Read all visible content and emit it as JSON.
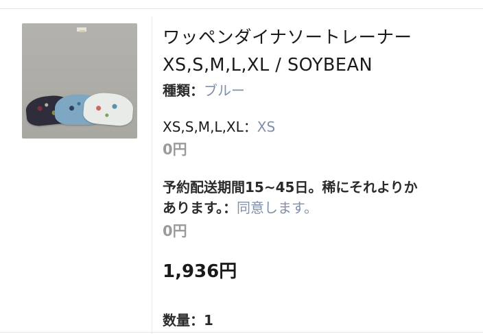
{
  "item": {
    "title_line1": "ワッペンダイナソートレーナー",
    "title_line2": "XS,S,M,L,XL  /  SOYBEAN",
    "type_label": "種類：",
    "type_value": "ブルー",
    "size_label": "XS,S,M,L,XL：",
    "size_value": "XS",
    "size_price": "0円",
    "delivery_label_line1": "予約配送期間15~45日。稀にそれよりか",
    "delivery_label_line2": "あります。：",
    "delivery_value": "同意します。",
    "delivery_price": "0円",
    "total_price": "1,936円",
    "quantity_label": "数量：",
    "quantity_value": "1"
  },
  "image": {
    "icon": "product-photo-sweatshirts"
  }
}
